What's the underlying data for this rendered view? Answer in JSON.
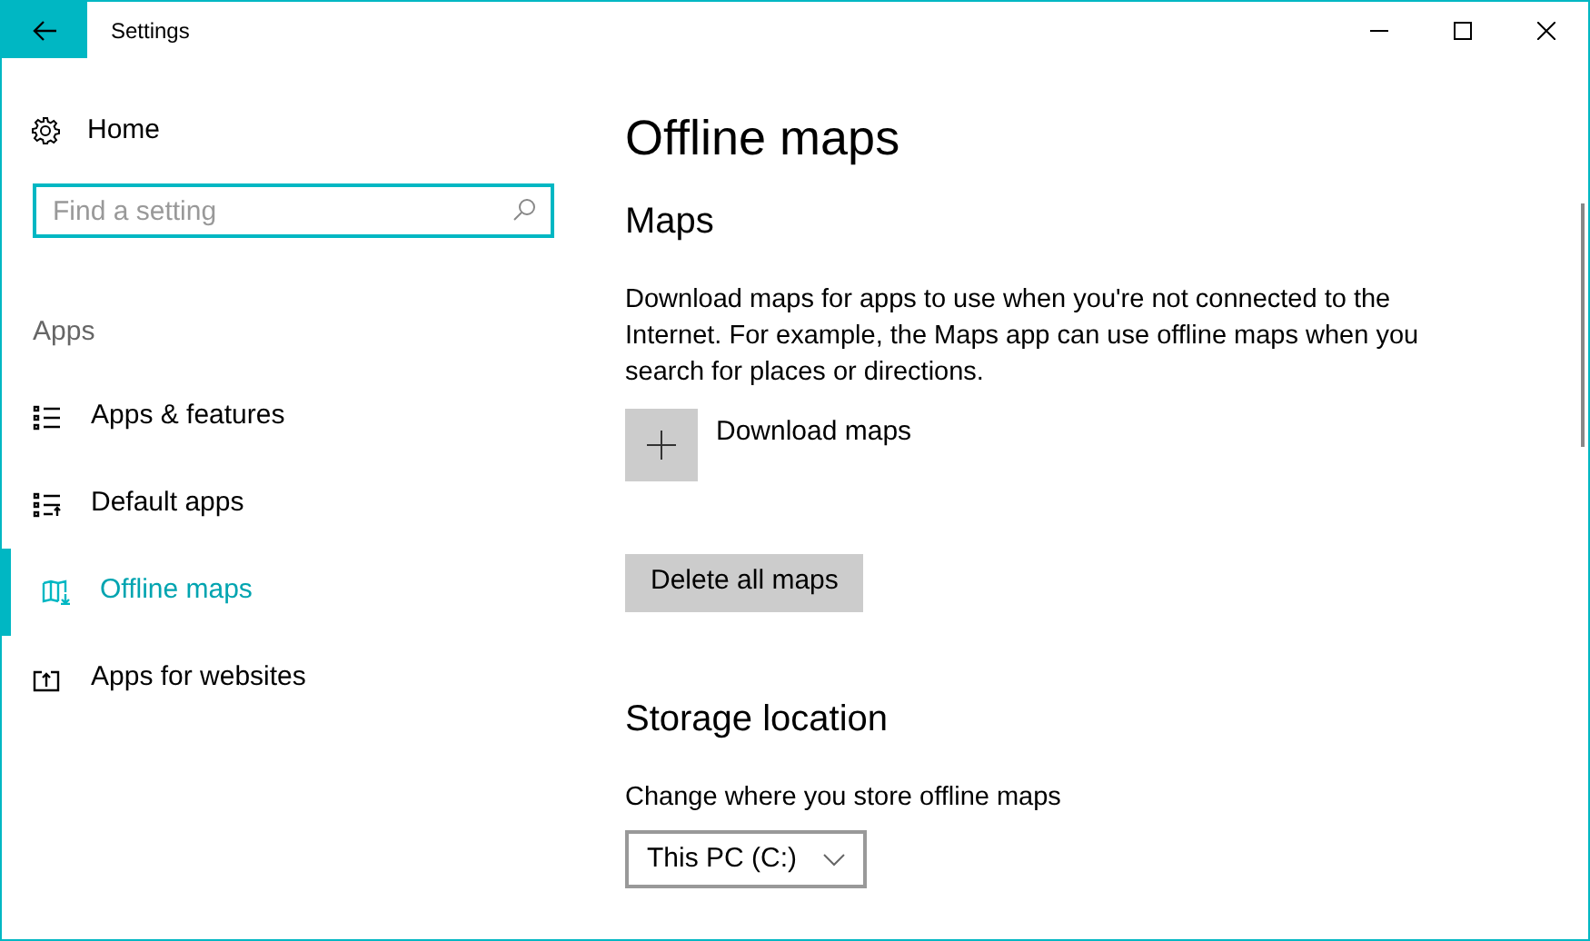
{
  "window": {
    "title": "Settings"
  },
  "sidebar": {
    "home": "Home",
    "search": {
      "placeholder": "Find a setting"
    },
    "section": "Apps",
    "items": [
      {
        "label": "Apps & features",
        "kind": "list",
        "selected": false
      },
      {
        "label": "Default apps",
        "kind": "defaults",
        "selected": false
      },
      {
        "label": "Offline maps",
        "kind": "map",
        "selected": true
      },
      {
        "label": "Apps for websites",
        "kind": "web",
        "selected": false
      }
    ]
  },
  "page": {
    "title": "Offline maps",
    "sections": [
      {
        "heading": "Maps",
        "description": "Download maps for apps to use when you're not connected to the Internet. For example, the Maps app can use offline maps when you search for places or directions.",
        "download": "Download maps",
        "delete": "Delete all maps"
      },
      {
        "heading": "Storage location",
        "description": "Change where you store offline maps",
        "dropdown": "This PC (C:)"
      }
    ]
  }
}
